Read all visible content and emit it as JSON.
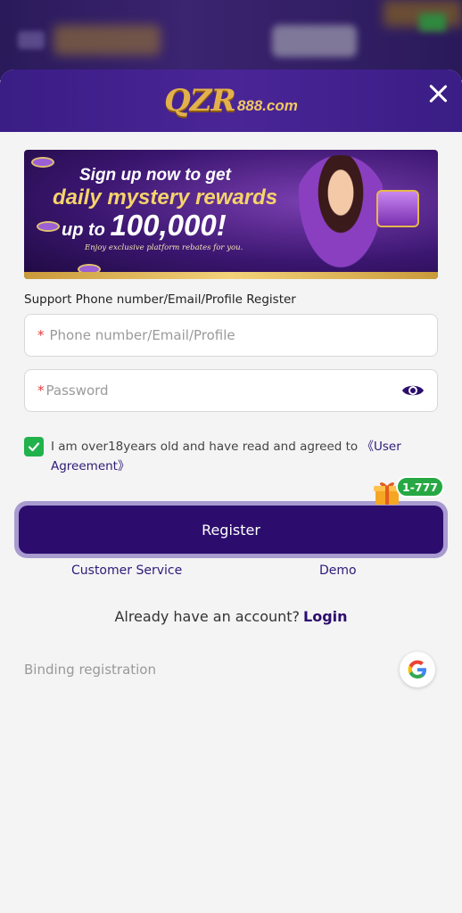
{
  "header": {
    "logo_main": "QZR",
    "logo_sub": "888.com"
  },
  "banner": {
    "line1": "Sign up now to get",
    "line2": "daily mystery rewards",
    "line3_prefix": "up to ",
    "line3_amount": "100,000!",
    "line4": "Enjoy exclusive platform rebates for you."
  },
  "form": {
    "support_label": "Support Phone number/Email/Profile Register",
    "account_required": "*",
    "account_placeholder": "Phone number/Email/Profile",
    "password_required": "*",
    "password_placeholder": "Password",
    "agree_text": "I am over18years old and have read and agreed to ",
    "agree_link": "《User Agreement》",
    "register_label": "Register",
    "gift_badge": "1-777",
    "customer_service": "Customer Service",
    "demo": "Demo",
    "already_text": "Already have an account?",
    "login_label": "Login",
    "binding_label": "Binding registration"
  },
  "colors": {
    "header_bg": "#3a1d85",
    "primary": "#2c0d6e",
    "checkbox": "#21b24b",
    "badge": "#27a844"
  }
}
